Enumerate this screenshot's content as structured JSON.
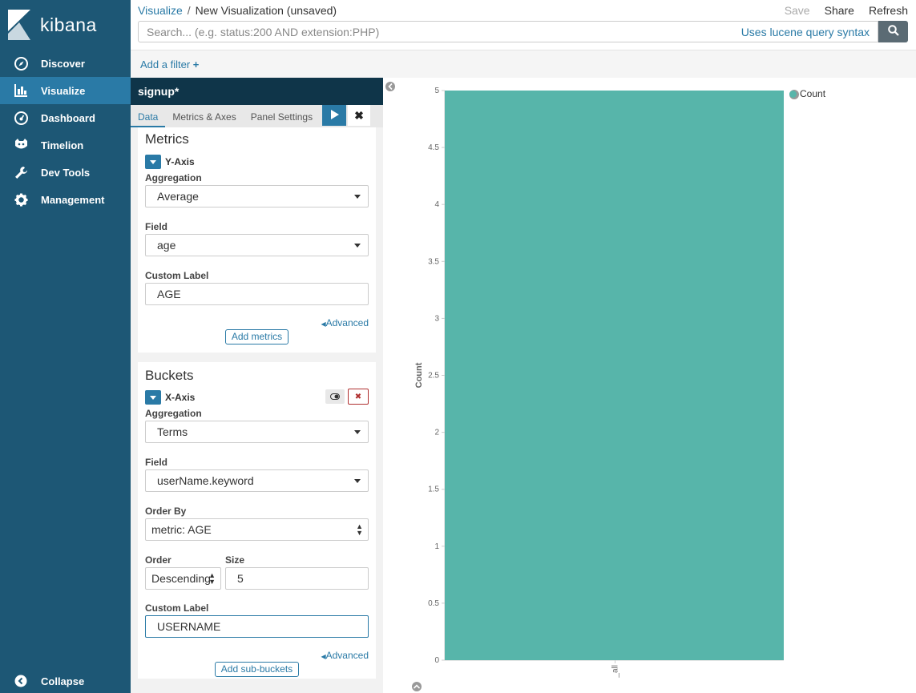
{
  "brand": {
    "name": "kibana"
  },
  "sidebar": {
    "items": [
      {
        "label": "Discover",
        "icon": "compass-icon",
        "active": false
      },
      {
        "label": "Visualize",
        "icon": "bar-chart-icon",
        "active": true
      },
      {
        "label": "Dashboard",
        "icon": "dashboard-icon",
        "active": false
      },
      {
        "label": "Timelion",
        "icon": "timelion-icon",
        "active": false
      },
      {
        "label": "Dev Tools",
        "icon": "wrench-icon",
        "active": false
      },
      {
        "label": "Management",
        "icon": "gear-icon",
        "active": false
      }
    ],
    "collapse_label": "Collapse"
  },
  "header": {
    "breadcrumb_root": "Visualize",
    "breadcrumb_sep": "/",
    "breadcrumb_current": "New Visualization (unsaved)",
    "save_label": "Save",
    "share_label": "Share",
    "refresh_label": "Refresh"
  },
  "search": {
    "placeholder": "Search... (e.g. status:200 AND extension:PHP)",
    "syntax_link": "Uses lucene query syntax"
  },
  "filter": {
    "add_label": "Add a filter"
  },
  "editor": {
    "title": "signup*",
    "tabs": [
      "Data",
      "Metrics & Axes",
      "Panel Settings"
    ],
    "metrics": {
      "heading": "Metrics",
      "axis_label": "Y-Axis",
      "aggregation_label": "Aggregation",
      "aggregation_value": "Average",
      "field_label": "Field",
      "field_value": "age",
      "custom_label_label": "Custom Label",
      "custom_label_value": "AGE",
      "advanced_label": "Advanced",
      "add_button": "Add metrics"
    },
    "buckets": {
      "heading": "Buckets",
      "axis_label": "X-Axis",
      "aggregation_label": "Aggregation",
      "aggregation_value": "Terms",
      "field_label": "Field",
      "field_value": "userName.keyword",
      "order_by_label": "Order By",
      "order_by_value": "metric: AGE",
      "order_label": "Order",
      "order_value": "Descending",
      "size_label": "Size",
      "size_value": "5",
      "custom_label_label": "Custom Label",
      "custom_label_value": "USERNAME",
      "advanced_label": "Advanced",
      "add_button": "Add sub-buckets"
    }
  },
  "colors": {
    "bar": "#57b5aa",
    "accent": "#2a7aa6",
    "sidebar": "#1d5775"
  },
  "chart_data": {
    "type": "bar",
    "categories": [
      "_all"
    ],
    "series": [
      {
        "name": "Count",
        "values": [
          5
        ]
      }
    ],
    "ylabel": "Count",
    "xlabel": "",
    "ylim": [
      0,
      5
    ],
    "yticks": [
      "0",
      "0.5",
      "1",
      "1.5",
      "2",
      "2.5",
      "3",
      "3.5",
      "4",
      "4.5",
      "5"
    ],
    "legend_position": "top-right",
    "grid": false
  }
}
